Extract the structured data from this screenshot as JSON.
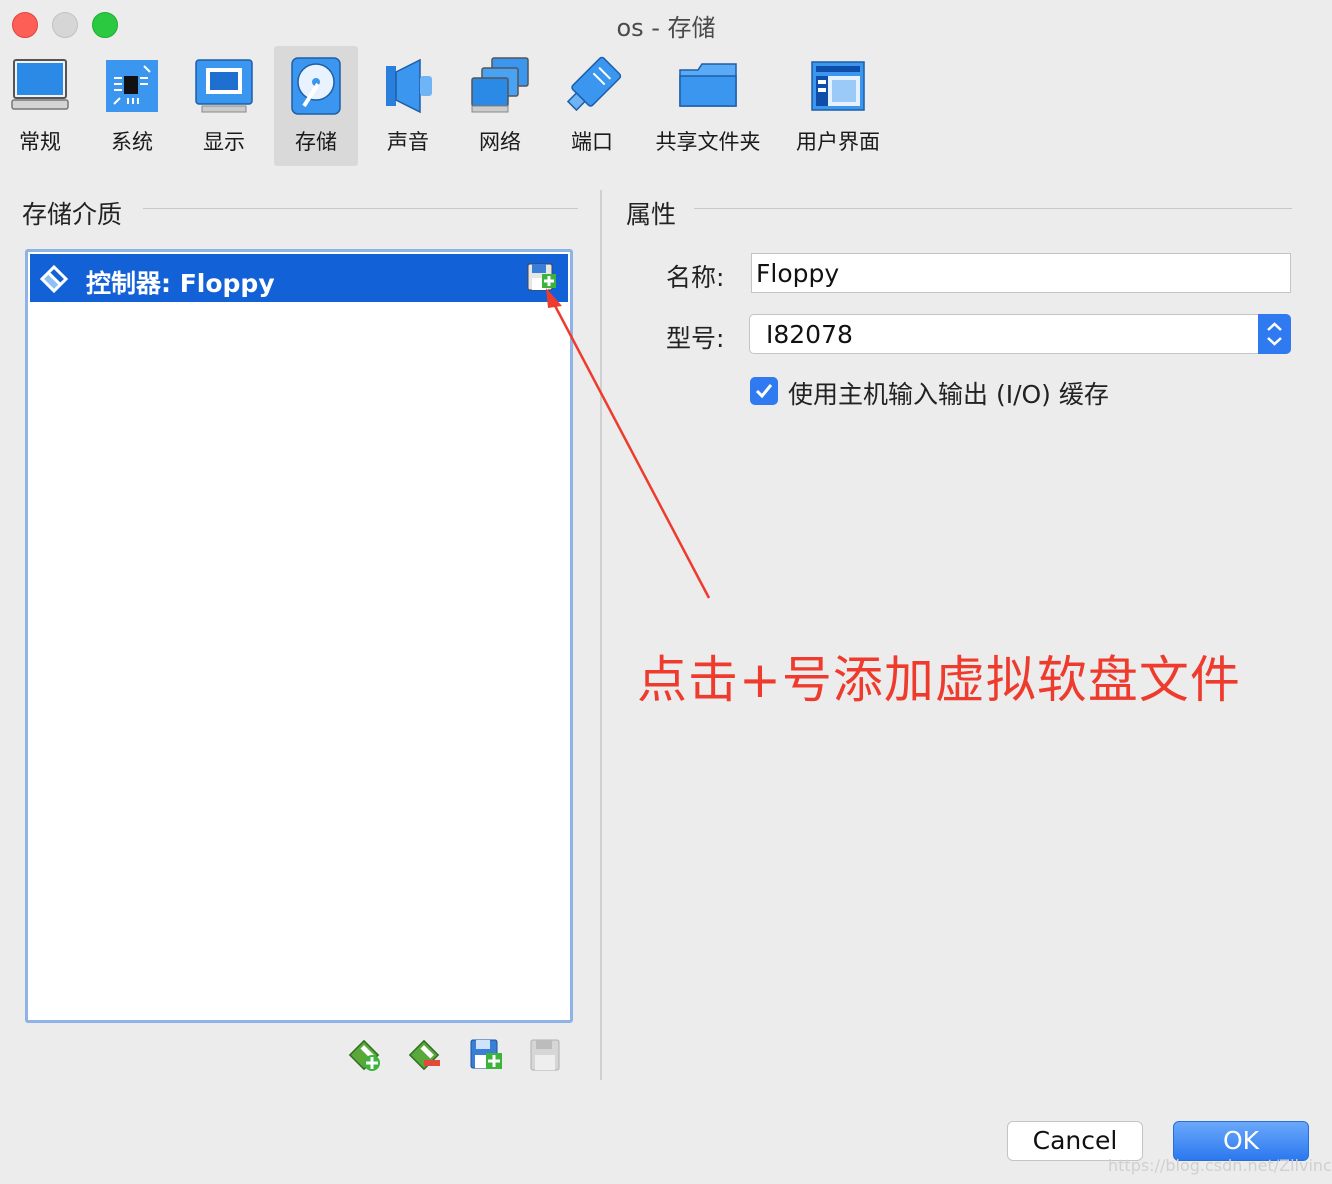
{
  "window": {
    "title": "os  - 存储"
  },
  "toolbar": {
    "items": [
      {
        "label": "常规",
        "icon": "general-monitor-icon"
      },
      {
        "label": "系统",
        "icon": "system-chip-icon"
      },
      {
        "label": "显示",
        "icon": "display-icon"
      },
      {
        "label": "存储",
        "icon": "storage-disk-icon",
        "active": true
      },
      {
        "label": "声音",
        "icon": "speaker-icon"
      },
      {
        "label": "网络",
        "icon": "network-icon"
      },
      {
        "label": "端口",
        "icon": "port-connector-icon"
      },
      {
        "label": "共享文件夹",
        "icon": "shared-folder-icon"
      },
      {
        "label": "用户界面",
        "icon": "user-interface-icon"
      }
    ]
  },
  "storage": {
    "title": "存储介质",
    "controller_label": "控制器: Floppy"
  },
  "properties": {
    "title": "属性",
    "name_label": "名称:",
    "name_value": "Floppy",
    "type_label": "型号:",
    "type_value": "I82078",
    "cache_label": "使用主机输入输出 (I/O) 缓存",
    "cache_checked": true
  },
  "annotation": {
    "text": "点击+号添加虚拟软盘文件",
    "color": "#ee3b2d"
  },
  "buttons": {
    "cancel": "Cancel",
    "ok": "OK"
  },
  "watermark": "https://blog.csdn.net/Zllvincent",
  "colors": {
    "accent": "#2f7af0",
    "selection": "#1261d6"
  }
}
